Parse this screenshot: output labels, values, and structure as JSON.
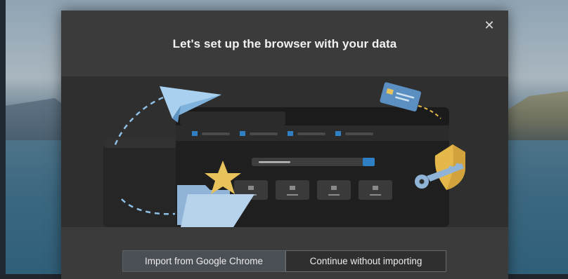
{
  "dialog": {
    "title": "Let's set up the browser with your data",
    "close_label": "✕"
  },
  "buttons": {
    "import_label": "Import from Google Chrome",
    "continue_label": "Continue without importing"
  },
  "icons": [
    "close-icon",
    "paper-plane-icon",
    "credit-card-icon",
    "star-icon",
    "folder-icon",
    "shield-icon",
    "key-icon"
  ],
  "colors": {
    "accent": "#2f7fc4",
    "star": "#e8c25a",
    "shield": "#e4b84a",
    "card": "#5b8fc2",
    "plane": "#8fc0e6"
  }
}
